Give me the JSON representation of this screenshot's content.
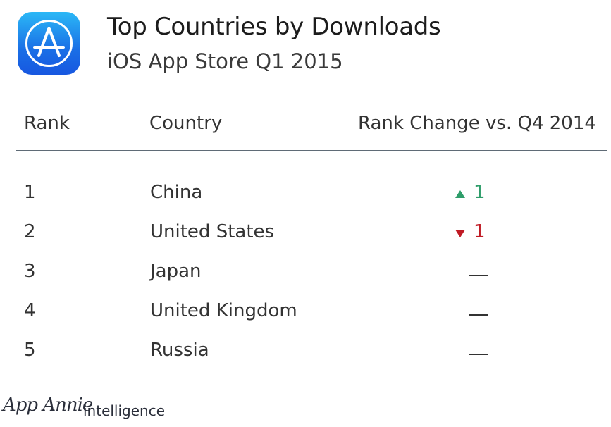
{
  "header": {
    "icon": "app-store-icon",
    "title": "Top Countries by Downloads",
    "subtitle": "iOS App Store Q1 2015"
  },
  "table": {
    "columns": [
      "Rank",
      "Country",
      "Rank Change vs. Q4 2014"
    ],
    "rows": [
      {
        "rank": "1",
        "country": "China",
        "change_dir": "up",
        "change": "1"
      },
      {
        "rank": "2",
        "country": "United States",
        "change_dir": "down",
        "change": "1"
      },
      {
        "rank": "3",
        "country": "Japan",
        "change_dir": "none",
        "change": ""
      },
      {
        "rank": "4",
        "country": "United Kingdom",
        "change_dir": "none",
        "change": ""
      },
      {
        "rank": "5",
        "country": "Russia",
        "change_dir": "none",
        "change": ""
      }
    ]
  },
  "colors": {
    "up": "#2e9d6a",
    "down": "#c01a24",
    "divider": "#5f6b76"
  },
  "footer": {
    "brand": "App Annie",
    "product": "intelligence"
  },
  "chart_data": {
    "type": "table",
    "title": "Top Countries by Downloads",
    "subtitle": "iOS App Store Q1 2015",
    "columns": [
      "Rank",
      "Country",
      "Rank Change vs. Q4 2014"
    ],
    "rows": [
      [
        1,
        "China",
        "+1"
      ],
      [
        2,
        "United States",
        "-1"
      ],
      [
        3,
        "Japan",
        "0"
      ],
      [
        4,
        "United Kingdom",
        "0"
      ],
      [
        5,
        "Russia",
        "0"
      ]
    ]
  }
}
